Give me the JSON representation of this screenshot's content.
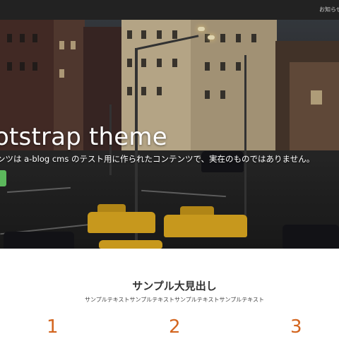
{
  "navbar": {
    "link_label": "お知らせ"
  },
  "hero": {
    "title": "otstrap theme",
    "lead": "ンツは a-blog cms のテスト用に作られたコンテンツで、実在のものではありません。",
    "button_color": "#5cb85c"
  },
  "section": {
    "heading": "サンプル大見出し",
    "text": "サンプルテキストサンプルテキストサンプルテキストサンプルテキスト",
    "numbers": [
      "1",
      "2",
      "3"
    ],
    "number_color": "#d3651f"
  }
}
